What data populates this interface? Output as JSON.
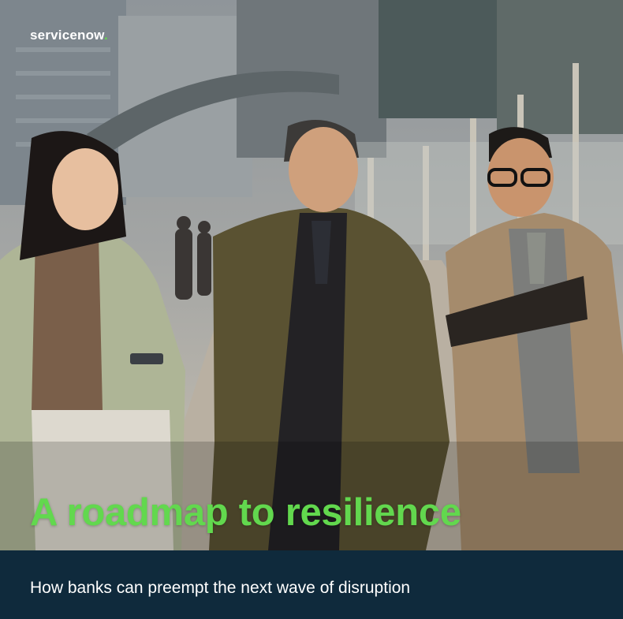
{
  "brand": {
    "logo_text": "servicenow",
    "logo_dot": ".",
    "accent_color": "#62d84e",
    "band_color": "#0f2a3c"
  },
  "cover": {
    "title": "A roadmap to resilience",
    "subtitle": "How banks can preempt the next wave of disruption"
  }
}
